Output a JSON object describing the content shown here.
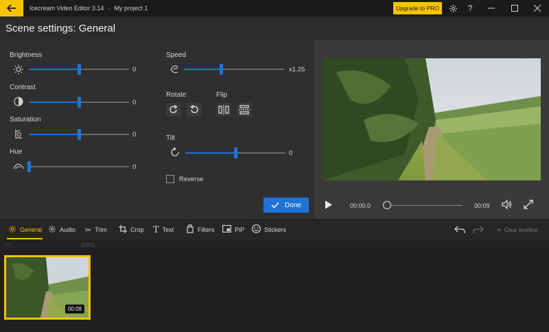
{
  "titlebar": {
    "app_title": "Icecream Video Editor 3.14",
    "separator": "-",
    "project_title": "My project 1",
    "upgrade_label": "Upgrade to PRO"
  },
  "scene": {
    "title": "Scene settings: General"
  },
  "settings": {
    "brightness": {
      "label": "Brightness",
      "value": "0",
      "level": 0.5
    },
    "contrast": {
      "label": "Contrast",
      "value": "0",
      "level": 0.5
    },
    "saturation": {
      "label": "Saturation",
      "value": "0",
      "level": 0.5
    },
    "hue": {
      "label": "Hue",
      "value": "0",
      "level": 0.0
    },
    "speed": {
      "label": "Speed",
      "value": "x1.25",
      "level": 0.37
    },
    "rotate": {
      "label": "Rotate"
    },
    "flip": {
      "label": "Flip"
    },
    "tilt": {
      "label": "Tilt",
      "value": "0",
      "level": 0.5
    },
    "reverse": {
      "label": "Reverse"
    },
    "done_label": "Done"
  },
  "preview": {
    "current_time": "00:00.0",
    "duration": "00:09"
  },
  "tabs": [
    {
      "label": "General",
      "icon": "gear-icon"
    },
    {
      "label": "Audio",
      "icon": "audio-icon"
    },
    {
      "label": "Trim",
      "icon": "scissors-icon"
    },
    {
      "label": "Crop",
      "icon": "crop-icon"
    },
    {
      "label": "Text",
      "icon": "text-icon"
    },
    {
      "label": "Filters",
      "icon": "filters-icon"
    },
    {
      "label": "PiP",
      "icon": "pip-icon"
    },
    {
      "label": "Stickers",
      "icon": "sticker-icon"
    }
  ],
  "timeline": {
    "clear_label": "Clear timeline",
    "clip_duration": "00:09"
  },
  "colors": {
    "accent": "#f5c400",
    "slider": "#1e73d6"
  }
}
